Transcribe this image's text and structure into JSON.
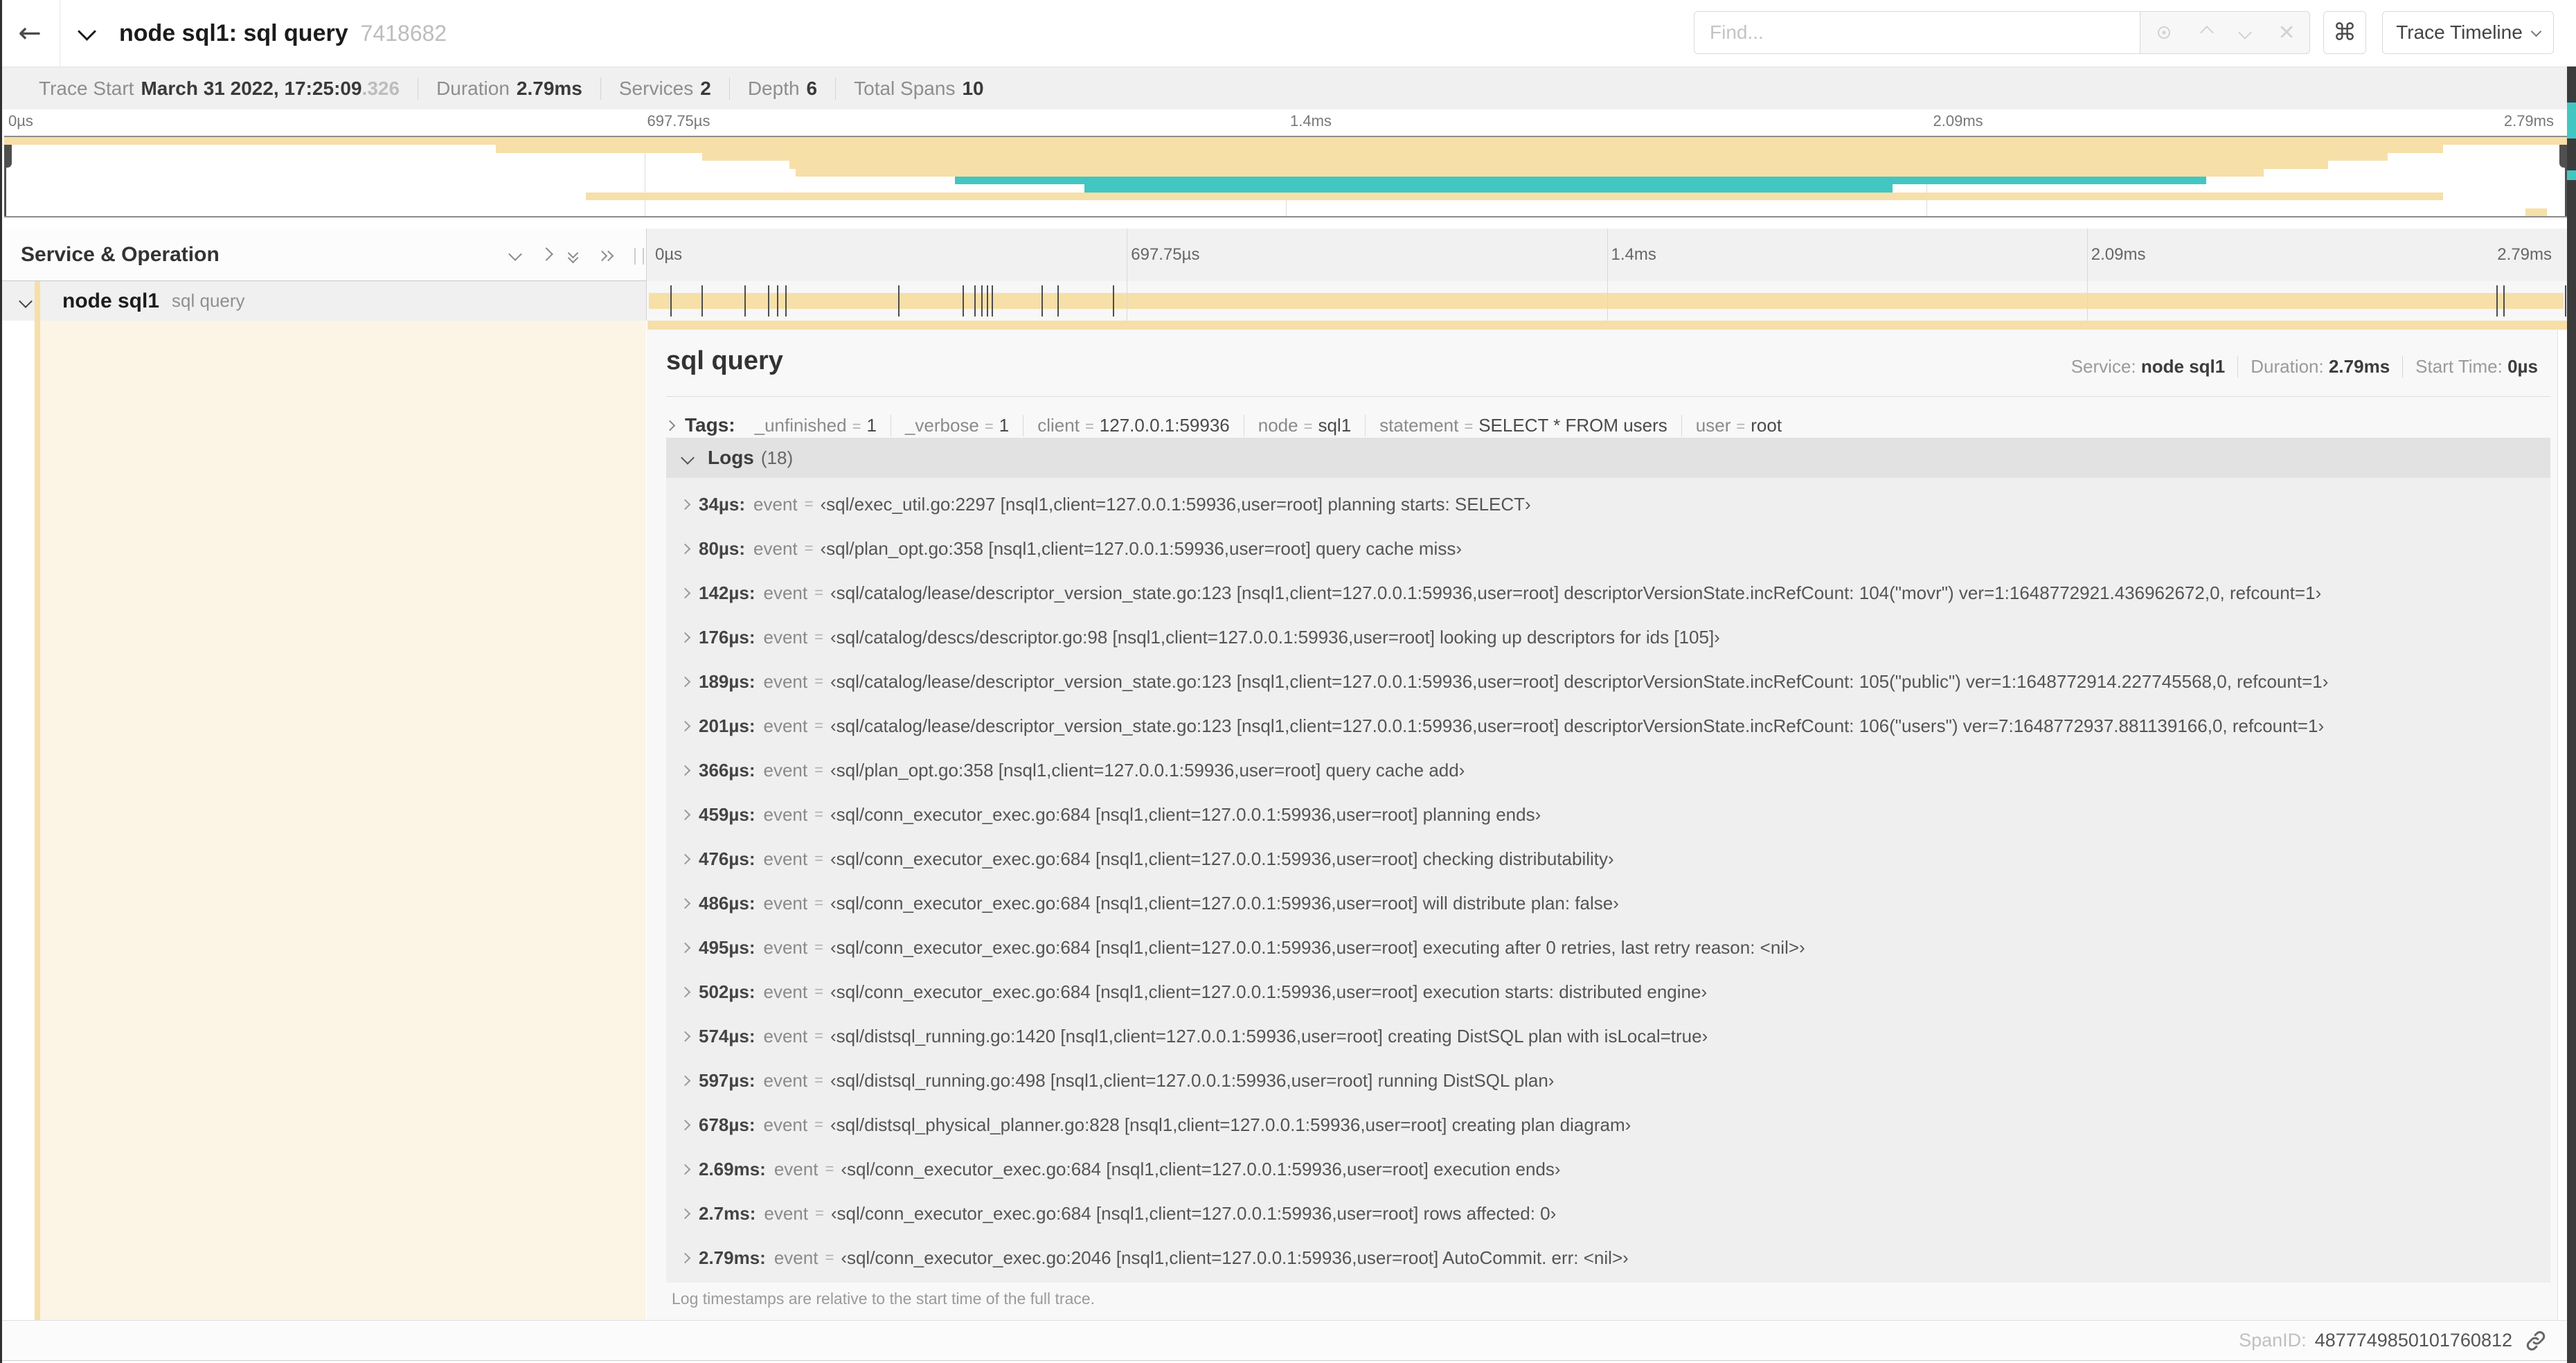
{
  "colors": {
    "tan": "#F7DFA8",
    "teal": "#42C6C2",
    "cream": "#FCF5E6"
  },
  "header": {
    "back_icon": "←",
    "title": "node sql1: sql query",
    "trace_id": "7418682",
    "find_placeholder": "Find...",
    "clear_icon": "✕",
    "shortcut_icon": "⌘",
    "view_button": "Trace Timeline"
  },
  "summary": {
    "items": [
      {
        "label": "Trace Start",
        "value": "March 31 2022, 17:25:09",
        "suffix": ".326"
      },
      {
        "label": "Duration",
        "value": "2.79ms"
      },
      {
        "label": "Services",
        "value": "2"
      },
      {
        "label": "Depth",
        "value": "6"
      },
      {
        "label": "Total Spans",
        "value": "10"
      }
    ]
  },
  "minimap": {
    "duration_us": 2790,
    "ticks": [
      "0µs",
      "697.75µs",
      "1.4ms",
      "2.09ms",
      "2.79ms"
    ],
    "spans": [
      {
        "row": 0,
        "start": 0,
        "end": 2790,
        "color": "tan"
      },
      {
        "row": 1,
        "start": 535,
        "end": 2655,
        "color": "tan"
      },
      {
        "row": 2,
        "start": 760,
        "end": 2595,
        "color": "tan"
      },
      {
        "row": 3,
        "start": 855,
        "end": 2530,
        "color": "tan"
      },
      {
        "row": 4,
        "start": 862,
        "end": 2460,
        "color": "tan"
      },
      {
        "row": 5,
        "start": 1035,
        "end": 2397,
        "color": "teal"
      },
      {
        "row": 6,
        "start": 1176,
        "end": 2056,
        "color": "teal"
      },
      {
        "row": 7,
        "start": 633,
        "end": 2655,
        "color": "tan"
      },
      {
        "row": 9,
        "start": 2745,
        "end": 2768,
        "color": "tan"
      }
    ]
  },
  "timeline": {
    "header": "Service & Operation",
    "ticks": [
      "0µs",
      "697.75µs",
      "1.4ms",
      "2.09ms",
      "2.79ms"
    ],
    "row": {
      "service": "node sql1",
      "operation": "sql query"
    },
    "log_marks_us": [
      34,
      80,
      142,
      176,
      189,
      201,
      366,
      459,
      476,
      486,
      495,
      502,
      574,
      597,
      678,
      2690,
      2700,
      2790
    ]
  },
  "detail": {
    "title": "sql query",
    "service_label": "Service:",
    "service": "node sql1",
    "duration_label": "Duration:",
    "duration": "2.79ms",
    "start_label": "Start Time:",
    "start": "0µs",
    "tags_label": "Tags:",
    "tags": [
      {
        "key": "_unfinished",
        "value": "1"
      },
      {
        "key": "_verbose",
        "value": "1"
      },
      {
        "key": "client",
        "value": "127.0.0.1:59936"
      },
      {
        "key": "node",
        "value": "sql1"
      },
      {
        "key": "statement",
        "value": "SELECT * FROM users"
      },
      {
        "key": "user",
        "value": "root"
      }
    ],
    "logs_label": "Logs",
    "logs_count": "(18)",
    "log_key": "event",
    "log_bracket": "[nsql1,client=127.0.0.1:59936,user=root]",
    "logs": [
      {
        "t": "34µs:",
        "file": "sql/exec_util.go:2297",
        "msg": "planning starts: SELECT"
      },
      {
        "t": "80µs:",
        "file": "sql/plan_opt.go:358",
        "msg": "query cache miss"
      },
      {
        "t": "142µs:",
        "file": "sql/catalog/lease/descriptor_version_state.go:123",
        "msg": "descriptorVersionState.incRefCount: 104(\"movr\") ver=1:1648772921.436962672,0, refcount=1"
      },
      {
        "t": "176µs:",
        "file": "sql/catalog/descs/descriptor.go:98",
        "msg": "looking up descriptors for ids [105]"
      },
      {
        "t": "189µs:",
        "file": "sql/catalog/lease/descriptor_version_state.go:123",
        "msg": "descriptorVersionState.incRefCount: 105(\"public\") ver=1:1648772914.227745568,0, refcount=1"
      },
      {
        "t": "201µs:",
        "file": "sql/catalog/lease/descriptor_version_state.go:123",
        "msg": "descriptorVersionState.incRefCount: 106(\"users\") ver=7:1648772937.881139166,0, refcount=1"
      },
      {
        "t": "366µs:",
        "file": "sql/plan_opt.go:358",
        "msg": "query cache add"
      },
      {
        "t": "459µs:",
        "file": "sql/conn_executor_exec.go:684",
        "msg": "planning ends"
      },
      {
        "t": "476µs:",
        "file": "sql/conn_executor_exec.go:684",
        "msg": "checking distributability"
      },
      {
        "t": "486µs:",
        "file": "sql/conn_executor_exec.go:684",
        "msg": "will distribute plan: false"
      },
      {
        "t": "495µs:",
        "file": "sql/conn_executor_exec.go:684",
        "msg": "executing after 0 retries, last retry reason: <nil>"
      },
      {
        "t": "502µs:",
        "file": "sql/conn_executor_exec.go:684",
        "msg": "execution starts: distributed engine"
      },
      {
        "t": "574µs:",
        "file": "sql/distsql_running.go:1420",
        "msg": "creating DistSQL plan with isLocal=true"
      },
      {
        "t": "597µs:",
        "file": "sql/distsql_running.go:498",
        "msg": "running DistSQL plan"
      },
      {
        "t": "678µs:",
        "file": "sql/distsql_physical_planner.go:828",
        "msg": "creating plan diagram"
      },
      {
        "t": "2.69ms:",
        "file": "sql/conn_executor_exec.go:684",
        "msg": "execution ends"
      },
      {
        "t": "2.7ms:",
        "file": "sql/conn_executor_exec.go:684",
        "msg": "rows affected: 0"
      },
      {
        "t": "2.79ms:",
        "file": "sql/conn_executor_exec.go:2046",
        "msg": "AutoCommit. err: <nil>"
      }
    ],
    "footer": "Log timestamps are relative to the start time of the full trace.",
    "span_id_label": "SpanID:",
    "span_id": "4877749850101760812"
  }
}
